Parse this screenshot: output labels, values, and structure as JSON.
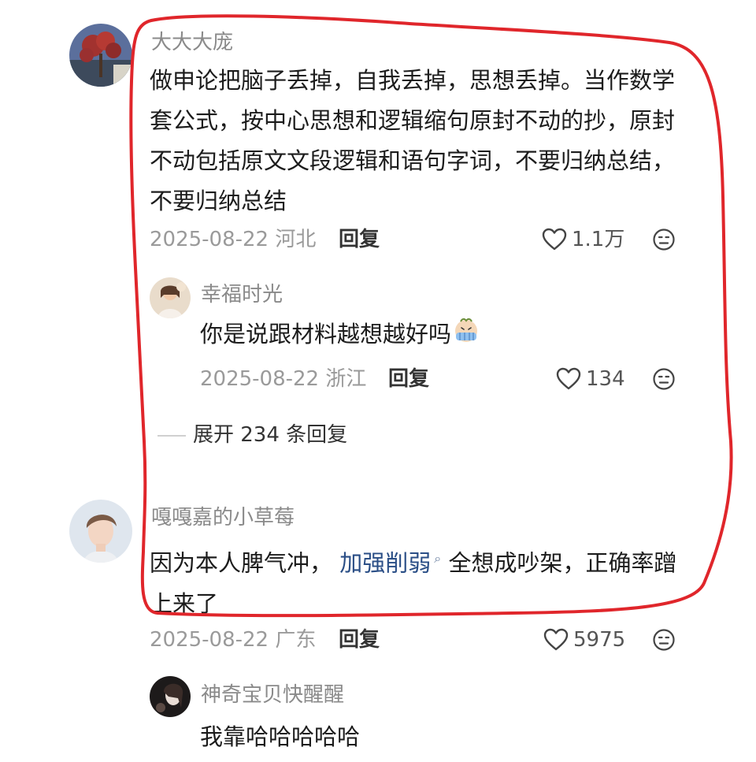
{
  "comments": [
    {
      "user": "大大大庞",
      "text": "做申论把脑子丢掉，自我丢掉，思想丢掉。当作数学套公式，按中心思想和逻辑缩句原封不动的抄，原封不动包括原文文段逻辑和语句字词，不要归纳总结，不要归纳总结",
      "date": "2025-08-22",
      "location": "河北",
      "reply_label": "回复",
      "likes": "1.1万",
      "replies": [
        {
          "user": "幸福时光",
          "text": "你是说跟材料越想越好吗",
          "date": "2025-08-22",
          "location": "浙江",
          "reply_label": "回复",
          "likes": "134"
        }
      ],
      "expand_label": "展开 234 条回复"
    },
    {
      "user": "嘎嘎嘉的小草莓",
      "text_before": "因为本人脾气冲，",
      "link_text": "加强削弱",
      "text_after": "全想成吵架，正确率蹭上来了",
      "date": "2025-08-22",
      "location": "广东",
      "reply_label": "回复",
      "likes": "5975",
      "replies": [
        {
          "user": "神奇宝贝快醒醒",
          "text": "我靠哈哈哈哈哈"
        }
      ]
    }
  ],
  "colors": {
    "annotation_outline": "#e0262b",
    "link": "#2a4e86"
  }
}
